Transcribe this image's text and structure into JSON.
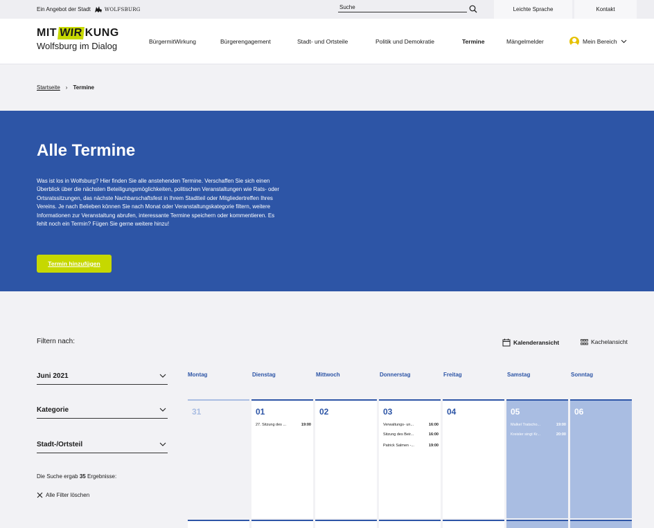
{
  "topbar": {
    "offer": "Ein Angebot der Stadt",
    "city": "WOLFSBURG",
    "search_label": "Suche",
    "easy_language": "Leichte Sprache",
    "contact": "Kontakt"
  },
  "logo": {
    "mit": "MIT",
    "wir": "WIR",
    "kung": "KUNG",
    "subtitle": "Wolfsburg im Dialog"
  },
  "nav": {
    "items": [
      {
        "label": "BürgermitWirkung"
      },
      {
        "label": "Bürgerengagement"
      },
      {
        "label": "Stadt- und Ortsteile"
      },
      {
        "label": "Politik und Demokratie"
      },
      {
        "label": "Termine"
      },
      {
        "label": "Mängelmelder"
      }
    ],
    "my_area": "Mein Bereich"
  },
  "breadcrumb": {
    "home": "Startseite",
    "sep": "›",
    "current": "Termine"
  },
  "hero": {
    "title": "Alle Termine",
    "text": "Was ist los in Wolfsburg? Hier finden Sie alle anstehenden Termine. Verschaffen Sie sich einen Überblick über die nächsten Beteiligungsmöglichkeiten, politischen Veranstaltungen wie Rats- oder Ortsratssitzungen, das nächste Nachbarschaftsfest in Ihrem Stadtteil oder Mitgliedertreffen Ihres Vereins. Je nach Belieben können Sie nach Monat oder Veranstaltungskategorie filtern, weitere Informationen zur Veranstaltung abrufen, interessante Termine speichern oder kommentieren. Es fehlt noch ein Termin? Fügen Sie gerne weitere hinzu!",
    "button": "Termin hinzufügen"
  },
  "filters": {
    "label": "Filtern nach:",
    "month": "Juni 2021",
    "category": "Kategorie",
    "district": "Stadt-/Ortsteil",
    "result_prefix": "Die Suche ergab",
    "result_count": "35",
    "result_suffix": "Ergebnisse:",
    "clear": "Alle Filter löschen"
  },
  "views": {
    "calendar": "Kalenderansicht",
    "tiles": "Kachelansicht"
  },
  "calendar": {
    "days": [
      "Montag",
      "Dienstag",
      "Mittwoch",
      "Donnerstag",
      "Freitag",
      "Samstag",
      "Sonntag"
    ],
    "cells": [
      {
        "num": "31",
        "events": []
      },
      {
        "num": "01",
        "events": [
          {
            "title": "27. Sitzung des ...",
            "time": "19:00"
          }
        ]
      },
      {
        "num": "02",
        "events": []
      },
      {
        "num": "03",
        "events": [
          {
            "title": "Verwaltungs- un...",
            "time": "16:00"
          },
          {
            "title": "Sitzung des Beir...",
            "time": "16:00"
          },
          {
            "title": "Patrick Salmen -...",
            "time": "19:00"
          }
        ]
      },
      {
        "num": "04",
        "events": []
      },
      {
        "num": "05",
        "events": [
          {
            "title": "Malkel Tratscho...",
            "time": "19:00"
          },
          {
            "title": "Kreisler singt Kr...",
            "time": "20:00"
          }
        ]
      },
      {
        "num": "06",
        "events": []
      }
    ]
  }
}
